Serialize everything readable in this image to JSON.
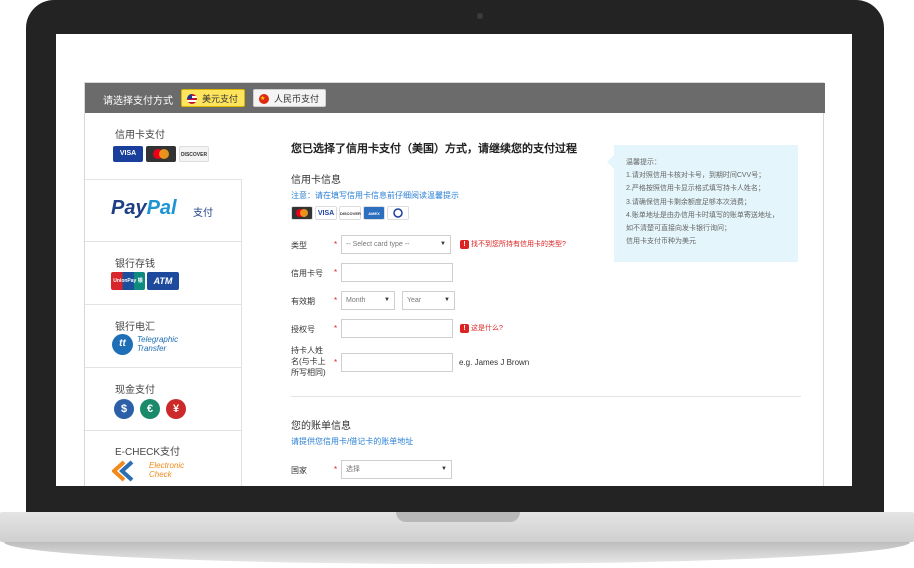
{
  "payment_method": {
    "prompt": "请选择支付方式",
    "currencies": [
      {
        "label": "美元支付",
        "selected": true
      },
      {
        "label": "人民币支付",
        "selected": false
      }
    ]
  },
  "sidebar": {
    "items": [
      {
        "title": "信用卡支付",
        "icons": [
          "VISA",
          "MasterCard",
          "DISCOVER"
        ]
      },
      {
        "title": "",
        "brand_pay": "Pay",
        "brand_pal": "Pal",
        "tag": "支付"
      },
      {
        "title": "银行存钱",
        "icons": [
          "UnionPay 银联",
          "ATM"
        ]
      },
      {
        "title": "银行电汇",
        "logo_line1": "Telegraphic",
        "logo_line2": "Transfer",
        "logo_mark": "tt"
      },
      {
        "title": "现金支付",
        "coins": [
          "$",
          "€",
          "¥"
        ]
      },
      {
        "title": "E-CHECK支付",
        "logo_line1": "Electronic",
        "logo_line2": "Check"
      }
    ]
  },
  "main": {
    "heading": "您已选择了信用卡支付（美国）方式，请继续您的支付过程",
    "card_info": {
      "title": "信用卡信息",
      "notice": "注意：请在填写信用卡信息前仔细阅读温馨提示",
      "card_icons": [
        "MC",
        "VISA",
        "DISCOVER",
        "AMEX",
        "DINERS"
      ]
    },
    "form": {
      "type_label": "类型",
      "type_placeholder": "-- Select card type --",
      "type_warning": "找不到您所持有信用卡的类型?",
      "number_label": "信用卡号",
      "expiry_label": "有效期",
      "month_placeholder": "Month",
      "year_placeholder": "Year",
      "auth_label": "授权号",
      "auth_warning": "这是什么?",
      "holder_label_1": "持卡人姓",
      "holder_label_2": "名(与卡上",
      "holder_label_3": "所写相同)",
      "holder_example": "e.g. James J Brown",
      "required_mark": "*"
    },
    "billing": {
      "title": "您的账单信息",
      "notice": "请提供您信用卡/借记卡的账单地址",
      "country_label": "国家",
      "country_placeholder": "选择"
    },
    "tips": {
      "title": "温馨提示：",
      "lines": [
        "1.请对照信用卡核对卡号，到期时间CVV号；",
        "2.严格按照信用卡显示格式填写持卡人姓名；",
        "3.请确保信用卡剩余额度足够本次消费；",
        "4.账单地址是由办信用卡时填写的账单寄送地址，",
        "如不清楚可直接向发卡银行询问；",
        "信用卡支付币种为美元"
      ]
    }
  },
  "colors": {
    "topbar": "#6b6b6b",
    "usd_button": "#ffe45c",
    "link": "#2a7fd4",
    "warning": "#dd2222",
    "tips_bg": "#e4f5fb",
    "paypal_dark": "#1e3f84",
    "paypal_light": "#1d95d3"
  }
}
